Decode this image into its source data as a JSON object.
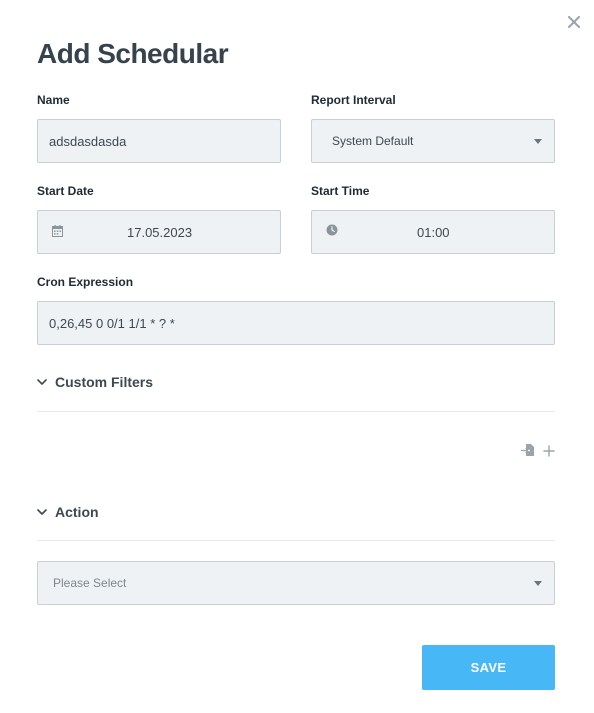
{
  "dialog": {
    "title": "Add Schedular",
    "close_icon": "close-icon"
  },
  "form": {
    "name": {
      "label": "Name",
      "value": "adsdasdasda"
    },
    "report_interval": {
      "label": "Report Interval",
      "value": "System Default"
    },
    "start_date": {
      "label": "Start Date",
      "value": "17.05.2023",
      "icon": "calendar-icon"
    },
    "start_time": {
      "label": "Start Time",
      "value": "01:00",
      "icon": "clock-icon"
    },
    "cron_expression": {
      "label": "Cron Expression",
      "value": "0,26,45 0 0/1 1/1 * ? *"
    }
  },
  "custom_filters": {
    "label": "Custom Filters",
    "import_icon": "import-file-icon",
    "add_icon": "plus-icon"
  },
  "action": {
    "label": "Action",
    "placeholder": "Please Select"
  },
  "buttons": {
    "save": "SAVE"
  },
  "colors": {
    "accent": "#47b8f5",
    "field_bg": "#eff2f4",
    "field_border": "#c9cfd4",
    "title": "#36424c"
  }
}
